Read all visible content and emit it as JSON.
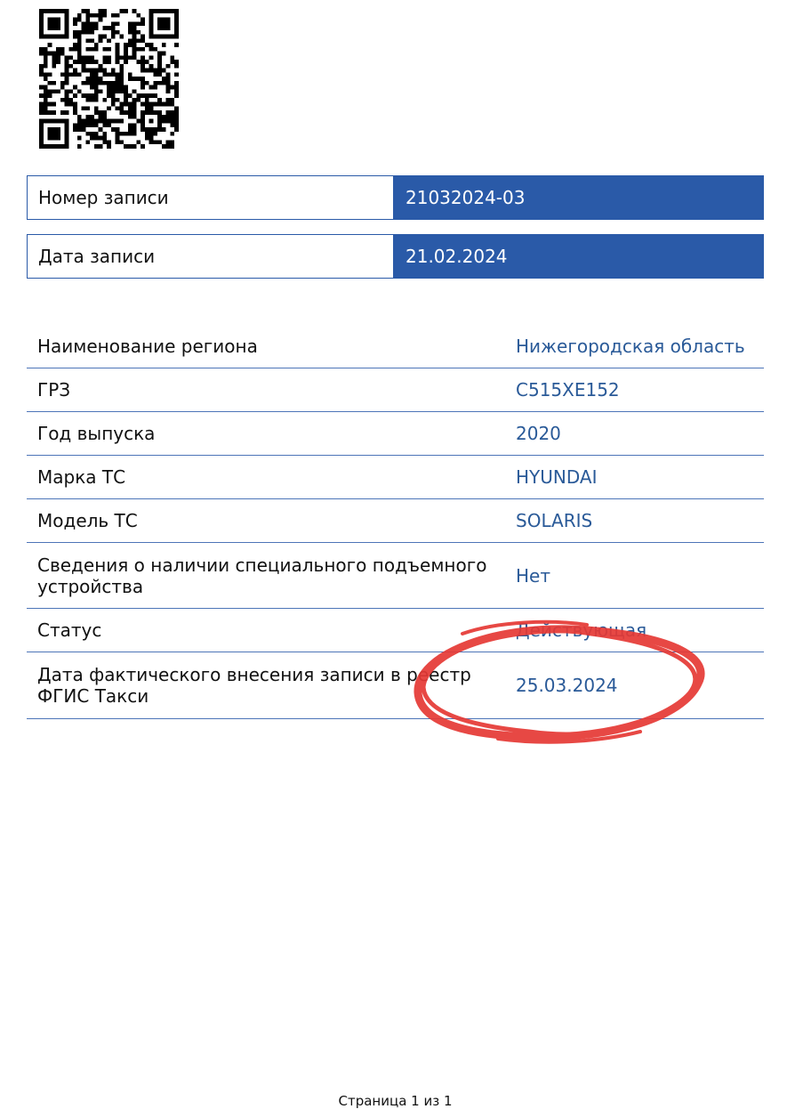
{
  "header": {
    "record_number_label": "Номер записи",
    "record_number_value": "21032024-03",
    "record_date_label": "Дата записи",
    "record_date_value": "21.02.2024"
  },
  "details": {
    "rows": [
      {
        "label": "Наименование региона",
        "value": "Нижегородская область"
      },
      {
        "label": "ГРЗ",
        "value": "С515ХЕ152"
      },
      {
        "label": "Год выпуска",
        "value": "2020"
      },
      {
        "label": "Марка ТС",
        "value": "HYUNDAI"
      },
      {
        "label": "Модель ТС",
        "value": "SOLARIS"
      },
      {
        "label": "Сведения о наличии специального подъемного устройства",
        "value": "Нет"
      },
      {
        "label": "Статус",
        "value": "Действующая"
      },
      {
        "label": "Дата фактического внесения записи в реестр ФГИС Такси",
        "value": "25.03.2024"
      }
    ]
  },
  "footer": {
    "page_label": "Страница 1 из 1"
  },
  "colors": {
    "accent": "#2a5aa8",
    "value_text": "#2a5a98",
    "annotation": "#e53935"
  },
  "icons": {
    "qr": "qr-code-icon"
  }
}
